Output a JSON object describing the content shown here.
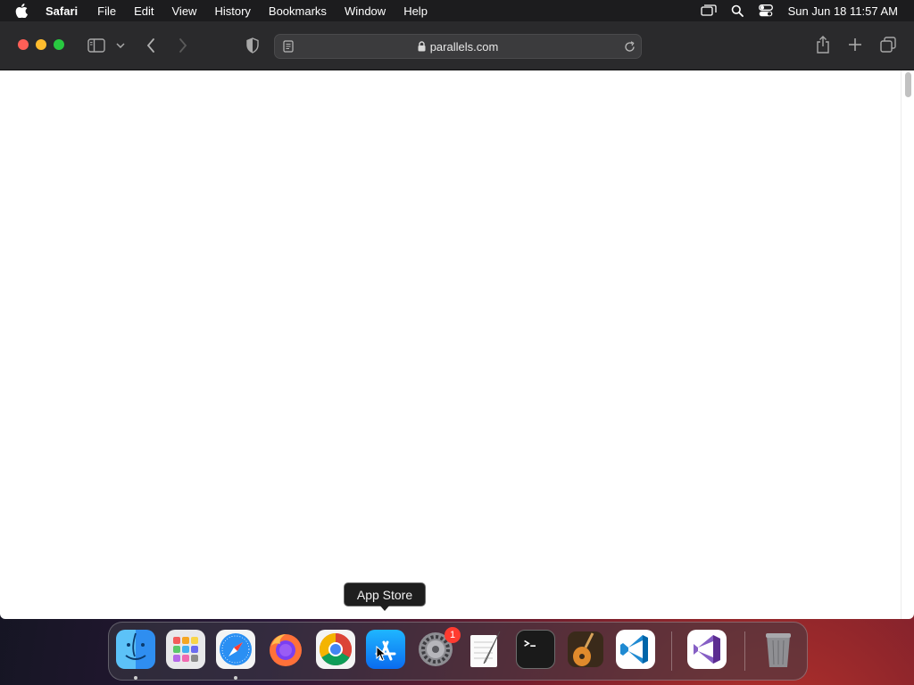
{
  "menubar": {
    "app_name": "Safari",
    "items": [
      "File",
      "Edit",
      "View",
      "History",
      "Bookmarks",
      "Window",
      "Help"
    ],
    "clock": "Sun Jun 18  11:57 AM",
    "status_icons": [
      "display-mirror-icon",
      "spotlight-search-icon",
      "control-center-icon"
    ]
  },
  "toolbar": {
    "url": "parallels.com",
    "secure": true
  },
  "tooltip": {
    "text": "App Store"
  },
  "dock": {
    "apps": [
      {
        "name": "Finder",
        "icon": "finder-icon",
        "running": true
      },
      {
        "name": "Launchpad",
        "icon": "launchpad-icon",
        "running": false
      },
      {
        "name": "Safari",
        "icon": "safari-icon",
        "running": true
      },
      {
        "name": "Firefox",
        "icon": "firefox-icon",
        "running": false
      },
      {
        "name": "Google Chrome",
        "icon": "chrome-icon",
        "running": false
      },
      {
        "name": "App Store",
        "icon": "app-store-icon",
        "running": false
      },
      {
        "name": "System Settings",
        "icon": "system-settings-icon",
        "running": false,
        "badge": "1"
      },
      {
        "name": "TextEdit",
        "icon": "textedit-icon",
        "running": false
      },
      {
        "name": "Terminal",
        "icon": "terminal-icon",
        "running": false
      },
      {
        "name": "GarageBand",
        "icon": "garageband-icon",
        "running": false
      },
      {
        "name": "Visual Studio Code",
        "icon": "vscode-icon",
        "running": false
      },
      {
        "name": "Visual Studio",
        "icon": "visual-studio-icon",
        "running": false
      },
      {
        "name": "Trash",
        "icon": "trash-icon",
        "running": false
      }
    ]
  },
  "colors": {
    "close": "#ff5f57",
    "minimize": "#febc2e",
    "maximize": "#28c840",
    "badge": "#ff3b30"
  }
}
